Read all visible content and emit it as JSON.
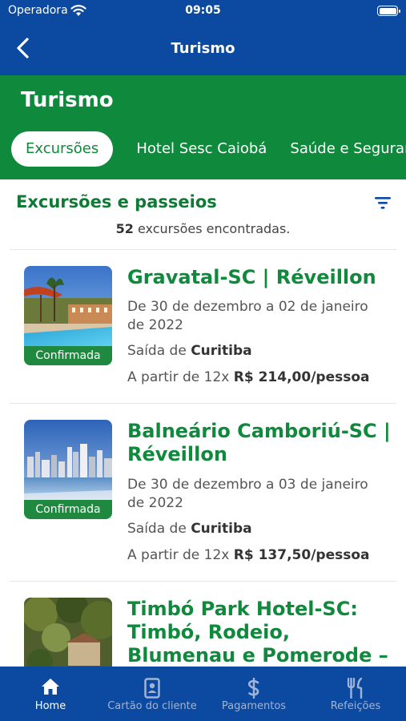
{
  "status": {
    "carrier": "Operadora",
    "time": "09:05"
  },
  "nav": {
    "title": "Turismo"
  },
  "header": {
    "title": "Turismo",
    "tabs": [
      {
        "label": "Excursões",
        "active": true
      },
      {
        "label": "Hotel Sesc Caiobá",
        "active": false
      },
      {
        "label": "Saúde e Segurança",
        "active": false
      }
    ]
  },
  "list": {
    "heading": "Excursões e passeios",
    "count": "52",
    "count_suffix": "excursões encontradas.",
    "items": [
      {
        "title": "Gravatal-SC | Réveillon",
        "badge": "Confirmada",
        "dates": "De 30 de dezembro a 02 de janeiro de 2022",
        "origin_prefix": "Saída de",
        "origin": "Curitiba",
        "price_prefix": "A partir de 12x",
        "price": "R$ 214,00/pessoa"
      },
      {
        "title": "Balneário Camboriú-SC | Réveillon",
        "badge": "Confirmada",
        "dates": "De 30 de dezembro a 03 de janeiro de 2022",
        "origin_prefix": "Saída de",
        "origin": "Curitiba",
        "price_prefix": "A partir de 12x",
        "price": "R$ 137,50/pessoa"
      },
      {
        "title": "Timbó Park Hotel-SC: Timbó, Rodeio, Blumenau e Pomerode –"
      }
    ]
  },
  "tabbar": [
    {
      "label": "Home",
      "icon": "home-icon",
      "active": true
    },
    {
      "label": "Cartão do cliente",
      "icon": "id-card-icon",
      "active": false
    },
    {
      "label": "Pagamentos",
      "icon": "dollar-icon",
      "active": false
    },
    {
      "label": "Refeições",
      "icon": "cutlery-icon",
      "active": false
    }
  ],
  "colors": {
    "navy": "#0b4aa0",
    "green": "#0f8a3c"
  }
}
